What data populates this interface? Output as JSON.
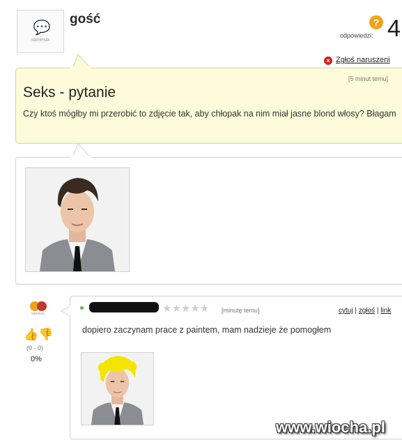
{
  "header": {
    "avatar_text": "samesia",
    "username": "gość",
    "answers_label": "odpowiedzi:",
    "answers_count": "4",
    "report_label": "Zgłoś naruszeni"
  },
  "question": {
    "time": "[5 minut temu]",
    "title": "Seks - pytanie",
    "body": "Czy ktoś mógłby mi przerobić to zdjęcie tak, aby chłopak na nim miał jasne blond włosy? Błagam"
  },
  "answer": {
    "time": "[minutę temu]",
    "link_quote": "cytuj",
    "link_sep": "|",
    "link_report": "zgłoś",
    "link_link": "link",
    "text": "dopiero zaczynam prace z paintem, mam nadzieje że pomogłem",
    "score_range": "(0 - 0)",
    "score_pct": "0%",
    "stars": "★★★★★"
  },
  "watermark": "www.wiocha.pl",
  "colors": {
    "question_bg": "#fdfbd9",
    "badge_orange": "#f0a21b",
    "report_red": "#d32222",
    "hair_yellow": "#f5e400"
  }
}
